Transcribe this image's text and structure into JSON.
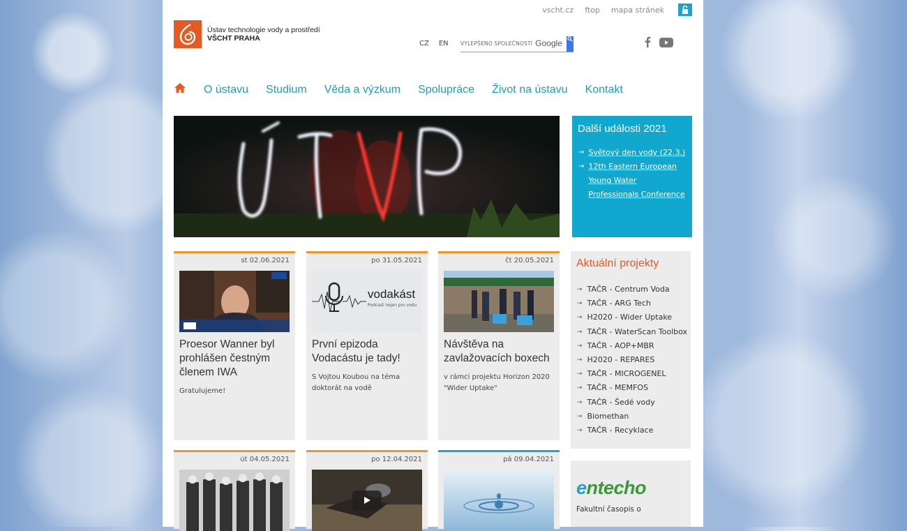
{
  "colors": {
    "accent": "#1f9bc4",
    "brand": "#e35a23",
    "events_bg": "#12a7cf",
    "card_border_orange": "#f0952b",
    "card_border_blue": "#22a5cd",
    "entecho_green": "#3a9a3a"
  },
  "top_links": [
    "vscht.cz",
    "ftop",
    "mapa stránek"
  ],
  "logo": {
    "line1": "Ústav technologie vody a prostředí",
    "line2": "VŠCHT PRAHA"
  },
  "languages": [
    "CZ",
    "EN"
  ],
  "search": {
    "placeholder": "VYLEPŠENO SPOLEČNOSTÍ",
    "brand": "Google"
  },
  "social": [
    "facebook-icon",
    "youtube-icon"
  ],
  "nav": {
    "home_icon": "home-icon",
    "items": [
      "O ústavu",
      "Studium",
      "Věda a výzkum",
      "Spolupráce",
      "Život na ústavu",
      "Kontakt"
    ]
  },
  "events": {
    "title": "Další události 2021",
    "items": [
      "Světový den vody (22.3.)",
      "12th Eastern European Young Water Professionals Conference"
    ]
  },
  "cards": [
    {
      "date": "st 02.06.2021",
      "title": "Proesor Wanner byl prohlášen čestným členem IWA",
      "text": "Gratulujeme!",
      "border": "orange"
    },
    {
      "date": "po 31.05.2021",
      "title": "První epizoda Vodacástu je tady!",
      "text": "S Vojtou Koubou na téma doktorát na vodě",
      "border": "orange",
      "image_text": {
        "title": "vodakást",
        "subtitle": "Podcast nejen pro vodu"
      }
    },
    {
      "date": "čt 20.05.2021",
      "title": "Návštěva na zavlažovacích boxech",
      "text": "v rámci projektu Horizon 2020 \"Wider Uptake\"",
      "border": "orange"
    },
    {
      "date": "út 04.05.2021",
      "border": "orange"
    },
    {
      "date": "po 12.04.2021",
      "border": "orange"
    },
    {
      "date": "pá 09.04.2021",
      "border": "blue"
    }
  ],
  "projects": {
    "title": "Aktuální projekty",
    "items": [
      "TAČR - Centrum Voda",
      "TAČR - ARG Tech",
      "H2020 - Wider Uptake",
      "TAČR - WaterScan Toolbox",
      "TAČR - AOP+MBR",
      "H2020 - REPARES",
      "TAČR - MICROGENEL",
      "TAČR - MEMFOS",
      "TAČR - Šedé vody",
      "Biomethan",
      "TAČR - Recyklace"
    ]
  },
  "entecho": {
    "logo_prefix": "e",
    "logo_main": "ntecho",
    "text": "Fakultní časopis o"
  }
}
